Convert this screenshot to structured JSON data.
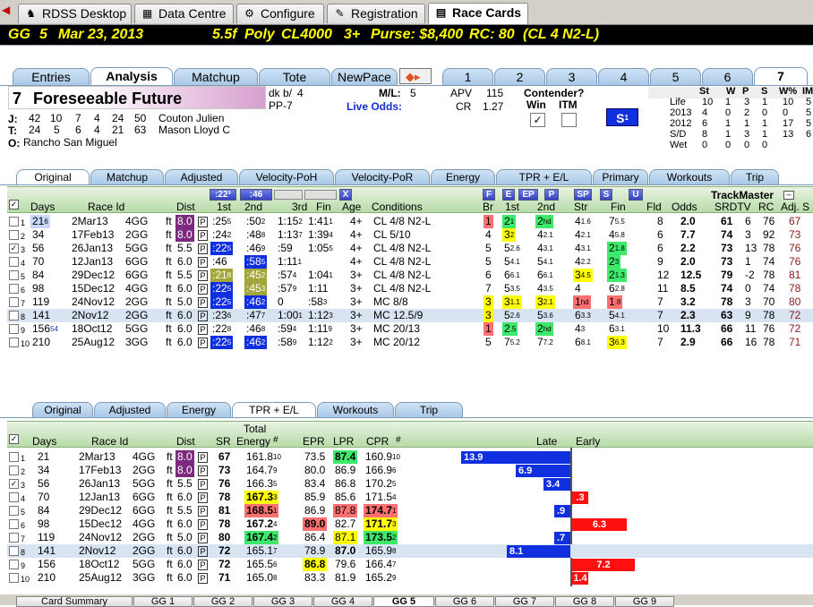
{
  "app_tabs": [
    {
      "label": "RDSS Desktop"
    },
    {
      "label": "Data Centre"
    },
    {
      "label": "Configure"
    },
    {
      "label": "Registration"
    },
    {
      "label": "Race Cards"
    }
  ],
  "race_header": {
    "track": "GG",
    "race": "5",
    "date": "Mar 23, 2013",
    "dist": "5.5f",
    "surface": "Poly",
    "class": "CL4000",
    "age": "3+",
    "purse": "Purse: $8,400",
    "rc": "RC: 80",
    "class_desc": "(CL 4 N2-L)"
  },
  "view_tabs": [
    "Entries",
    "Analysis",
    "Matchup",
    "Tote",
    "NewPace"
  ],
  "horse_tabs": [
    "1",
    "2",
    "3",
    "4",
    "5",
    "6",
    "7"
  ],
  "horse": {
    "pp": "7",
    "name": "Foreseeable Future",
    "color": "dk b/",
    "age": "4",
    "ppnum": "PP-7",
    "ml_label": "M/L:",
    "ml": "5",
    "live_odds": "Live Odds:",
    "apv_label": "APV",
    "apv": "115",
    "cr_label": "CR",
    "cr": "1.27",
    "contender": "Contender?",
    "win": "Win",
    "itm": "ITM",
    "s_badge": "S",
    "s_sup": "1"
  },
  "jockey": {
    "j": "J:",
    "stats": [
      "42",
      "10",
      "7",
      "4",
      "24",
      "50"
    ],
    "name": "Couton Julien"
  },
  "trainer": {
    "t": "T:",
    "stats": [
      "24",
      "5",
      "6",
      "4",
      "21",
      "63"
    ],
    "name": "Mason Lloyd C"
  },
  "owner": {
    "o": "O:",
    "name": "Rancho San Miguel"
  },
  "life_stats": {
    "headers": [
      "St",
      "W",
      "P",
      "S",
      "W%",
      "IM"
    ],
    "rows": [
      [
        "Life",
        "10",
        "1",
        "3",
        "1",
        "10",
        "5"
      ],
      [
        "2013",
        "4",
        "0",
        "2",
        "0",
        "0",
        "5"
      ],
      [
        "2012",
        "6",
        "1",
        "1",
        "1",
        "17",
        "5"
      ],
      [
        "S/D",
        "8",
        "1",
        "3",
        "1",
        "13",
        "6"
      ],
      [
        "Wet",
        "0",
        "0",
        "0",
        "0",
        "",
        ""
      ]
    ]
  },
  "pp_tabs": [
    "Original",
    "Matchup",
    "Adjusted",
    "Velocity-PoH",
    "Velocity-PoR",
    "Energy",
    "TPR + E/L",
    "Primary",
    "Workouts",
    "Trip"
  ],
  "pp_headers": {
    "days": "Days",
    "race_id": "Race Id",
    "dist": "Dist",
    "first": "1st",
    "second": "2nd",
    "third": "3rd",
    "fin": "Fin",
    "age": "Age",
    "conditions": "Conditions",
    "br": "Br",
    "c1": "1st",
    "c2": "2nd",
    "str": "Str",
    "fin2": "Fin",
    "fld": "Fld",
    "odds": "Odds",
    "srdtv": "SRDTV",
    "rc": "RC",
    "adj": "Adj. S",
    "trackmaster": "TrackMaster",
    "b223": ":22³",
    "b46": ":46",
    "bx": "X",
    "bF": "F",
    "bE": "E",
    "bEP": "EP",
    "bP": "P",
    "bSP": "SP",
    "bS": "S",
    "bU": "U"
  },
  "pp_rows": [
    {
      "n": "1",
      "days": "21",
      "dsup": "6",
      "date": "2Mar13",
      "trk": "4GG",
      "sf": "ft",
      "dist": "8.0",
      "f1": ":25",
      "f1s": "5",
      "f2": ":50",
      "f2s": "2",
      "f3": "1:15",
      "f3s": "2",
      "fin": "1:41",
      "fins": "1",
      "age": "4+",
      "cond": "CL 4/8 N2-L",
      "br": "1",
      "c1": "2",
      "c1s": "1",
      "c2": "2",
      "c2s": "hd",
      "str": "4",
      "strs": "1.6",
      "fn": "7",
      "fns": "5.5",
      "fld": "8",
      "odds": "2.0",
      "sr": "61",
      "tv": "6",
      "rc": "76",
      "adj": "67"
    },
    {
      "n": "2",
      "days": "34",
      "dsup": "",
      "date": "17Feb13",
      "trk": "2GG",
      "sf": "ft",
      "dist": "8.0",
      "f1": ":24",
      "f1s": "2",
      "f2": ":48",
      "f2s": "8",
      "f3": "1:13",
      "f3s": "7",
      "fin": "1:39",
      "fins": "4",
      "age": "4+",
      "cond": "CL 5/10",
      "br": "4",
      "c1": "3",
      "c1s": "2",
      "c2": "4",
      "c2s": "2.1",
      "str": "4",
      "strs": "2.1",
      "fn": "4",
      "fns": "5.8",
      "fld": "6",
      "odds": "7.7",
      "sr": "74",
      "tv": "3",
      "rc": "92",
      "adj": "73"
    },
    {
      "n": "3",
      "days": "56",
      "dsup": "",
      "date": "26Jan13",
      "trk": "5GG",
      "sf": "ft",
      "dist": "5.5",
      "f1": ":22",
      "f1s": "5",
      "f2": ":46",
      "f2s": "9",
      "f3": ":59",
      "f3s": "",
      "fin": "1:05",
      "fins": "5",
      "age": "4+",
      "cond": "CL 4/8 N2-L",
      "br": "5",
      "c1": "5",
      "c1s": "2.6",
      "c2": "4",
      "c2s": "3.1",
      "str": "4",
      "strs": "3.1",
      "fn": "2",
      "fns": "1.8",
      "fld": "6",
      "odds": "2.2",
      "sr": "73",
      "tv": "13",
      "rc": "78",
      "adj": "76"
    },
    {
      "n": "4",
      "days": "70",
      "dsup": "",
      "date": "12Jan13",
      "trk": "6GG",
      "sf": "ft",
      "dist": "6.0",
      "f1": ":46",
      "f1s": "",
      "f2": ":58",
      "f2s": "5",
      "f3": "1:11",
      "f3s": "1",
      "fin": "",
      "fins": "",
      "age": "4+",
      "cond": "CL 4/8 N2-L",
      "br": "5",
      "c1": "5",
      "c1s": "4.1",
      "c2": "5",
      "c2s": "4.1",
      "str": "4",
      "strs": "2.2",
      "fn": "2",
      "fns": "3",
      "fld": "9",
      "odds": "2.0",
      "sr": "73",
      "tv": "1",
      "rc": "74",
      "adj": "76"
    },
    {
      "n": "5",
      "days": "84",
      "dsup": "",
      "date": "29Dec12",
      "trk": "6GG",
      "sf": "ft",
      "dist": "5.5",
      "f1": ":21",
      "f1s": "8",
      "f2": ":45",
      "f2s": "2",
      "f3": ":57",
      "f3s": "4",
      "fin": "1:04",
      "fins": "1",
      "age": "3+",
      "cond": "CL 4/8 N2-L",
      "br": "6",
      "c1": "6",
      "c1s": "6.1",
      "c2": "6",
      "c2s": "6.1",
      "str": "3",
      "strs": "4.5",
      "fn": "2",
      "fns": "1.3",
      "fld": "12",
      "odds": "12.5",
      "sr": "79",
      "tv": "-2",
      "rc": "78",
      "adj": "81"
    },
    {
      "n": "6",
      "days": "98",
      "dsup": "",
      "date": "15Dec12",
      "trk": "4GG",
      "sf": "ft",
      "dist": "6.0",
      "f1": ":22",
      "f1s": "5",
      "f2": ":45",
      "f2s": "3",
      "f3": ":57",
      "f3s": "9",
      "fin": "1:11",
      "fins": "",
      "age": "3+",
      "cond": "CL 4/8 N2-L",
      "br": "7",
      "c1": "5",
      "c1s": "3.5",
      "c2": "4",
      "c2s": "3.5",
      "str": "4",
      "strs": "",
      "fn": "6",
      "fns": "2.8",
      "fld": "11",
      "odds": "8.5",
      "sr": "74",
      "tv": "0",
      "rc": "74",
      "adj": "78"
    },
    {
      "n": "7",
      "days": "119",
      "dsup": "",
      "date": "24Nov12",
      "trk": "2GG",
      "sf": "ft",
      "dist": "5.0",
      "f1": ":22",
      "f1s": "5",
      "f2": ":46",
      "f2s": "2",
      "f3": "0",
      "f3s": "",
      "fin": ":58",
      "fins": "3",
      "age": "3+",
      "cond": "MC 8/8",
      "br": "3",
      "c1": "3",
      "c1s": "1.1",
      "c2": "3",
      "c2s": "2.1",
      "str": "1",
      "strs": "hd",
      "fn": "1",
      "fns": ".8",
      "fld": "7",
      "odds": "3.2",
      "sr": "78",
      "tv": "3",
      "rc": "70",
      "adj": "80"
    },
    {
      "n": "8",
      "days": "141",
      "dsup": "",
      "date": "2Nov12",
      "trk": "2GG",
      "sf": "ft",
      "dist": "6.0",
      "f1": ":23",
      "f1s": "6",
      "f2": ":47",
      "f2s": "7",
      "f3": "1:00",
      "f3s": "1",
      "fin": "1:12",
      "fins": "3",
      "age": "3+",
      "cond": "MC 12.5/9",
      "br": "3",
      "c1": "5",
      "c1s": "2.6",
      "c2": "5",
      "c2s": "3.6",
      "str": "6",
      "strs": "3.3",
      "fn": "5",
      "fns": "4.1",
      "fld": "7",
      "odds": "2.3",
      "sr": "63",
      "tv": "9",
      "rc": "78",
      "adj": "72"
    },
    {
      "n": "9",
      "days": "156",
      "dsup": "54",
      "date": "18Oct12",
      "trk": "5GG",
      "sf": "ft",
      "dist": "6.0",
      "f1": ":22",
      "f1s": "8",
      "f2": ":46",
      "f2s": "8",
      "f3": ":59",
      "f3s": "4",
      "fin": "1:11",
      "fins": "9",
      "age": "3+",
      "cond": "MC 20/13",
      "br": "1",
      "c1": "2",
      "c1s": ".5",
      "c2": "2",
      "c2s": "hd",
      "str": "4",
      "strs": "3",
      "fn": "6",
      "fns": "3.1",
      "fld": "10",
      "odds": "11.3",
      "sr": "66",
      "tv": "11",
      "rc": "76",
      "adj": "72"
    },
    {
      "n": "10",
      "days": "210",
      "dsup": "",
      "date": "25Aug12",
      "trk": "3GG",
      "sf": "ft",
      "dist": "6.0",
      "f1": ":22",
      "f1s": "5",
      "f2": ":46",
      "f2s": "2",
      "f3": ":58",
      "f3s": "9",
      "fin": "1:12",
      "fins": "2",
      "age": "3+",
      "cond": "MC 20/12",
      "br": "5",
      "c1": "7",
      "c1s": "5.2",
      "c2": "7",
      "c2s": "7.2",
      "str": "6",
      "strs": "8.1",
      "fn": "3",
      "fns": "6.3",
      "fld": "7",
      "odds": "2.9",
      "sr": "66",
      "tv": "16",
      "rc": "78",
      "adj": "71"
    }
  ],
  "lower_tabs": [
    "Original",
    "Adjusted",
    "Energy",
    "TPR + E/L",
    "Workouts",
    "Trip"
  ],
  "lower_headers": {
    "days": "Days",
    "race_id": "Race Id",
    "dist": "Dist",
    "sr": "SR",
    "total": "Total",
    "energy": "Energy",
    "hash": "#",
    "epr": "EPR",
    "lpr": "LPR",
    "cpr": "CPR",
    "hash2": "#",
    "late": "Late",
    "early": "Early"
  },
  "lower_rows": [
    {
      "n": "1",
      "days": "21",
      "date": "2Mar13",
      "trk": "4GG",
      "sf": "ft",
      "dist": "8.0",
      "sr": "67",
      "energy": "161.8",
      "es": "10",
      "epr": "73.5",
      "lpr": "87.4",
      "cpr": "160.9",
      "cs": "10",
      "late": "13.9",
      "early": ""
    },
    {
      "n": "2",
      "days": "34",
      "date": "17Feb13",
      "trk": "2GG",
      "sf": "ft",
      "dist": "8.0",
      "sr": "73",
      "energy": "164.7",
      "es": "9",
      "epr": "80.0",
      "lpr": "86.9",
      "cpr": "166.9",
      "cs": "6",
      "late": "6.9",
      "early": ""
    },
    {
      "n": "3",
      "days": "56",
      "date": "26Jan13",
      "trk": "5GG",
      "sf": "ft",
      "dist": "5.5",
      "sr": "76",
      "energy": "166.3",
      "es": "5",
      "epr": "83.4",
      "lpr": "86.8",
      "cpr": "170.2",
      "cs": "5",
      "late": "3.4",
      "early": ""
    },
    {
      "n": "4",
      "days": "70",
      "date": "12Jan13",
      "trk": "6GG",
      "sf": "ft",
      "dist": "6.0",
      "sr": "78",
      "energy": "167.3",
      "es": "3",
      "epr": "85.9",
      "lpr": "85.6",
      "cpr": "171.5",
      "cs": "4",
      "late": "",
      "early": ".3"
    },
    {
      "n": "5",
      "days": "84",
      "date": "29Dec12",
      "trk": "6GG",
      "sf": "ft",
      "dist": "5.5",
      "sr": "81",
      "energy": "168.5",
      "es": "1",
      "epr": "86.9",
      "lpr": "87.8",
      "cpr": "174.7",
      "cs": "1",
      "late": ".9",
      "early": ""
    },
    {
      "n": "6",
      "days": "98",
      "date": "15Dec12",
      "trk": "4GG",
      "sf": "ft",
      "dist": "6.0",
      "sr": "78",
      "energy": "167.2",
      "es": "4",
      "epr": "89.0",
      "lpr": "82.7",
      "cpr": "171.7",
      "cs": "3",
      "late": "",
      "early": "6.3"
    },
    {
      "n": "7",
      "days": "119",
      "date": "24Nov12",
      "trk": "2GG",
      "sf": "ft",
      "dist": "5.0",
      "sr": "80",
      "energy": "167.4",
      "es": "2",
      "epr": "86.4",
      "lpr": "87.1",
      "cpr": "173.5",
      "cs": "2",
      "late": ".7",
      "early": ""
    },
    {
      "n": "8",
      "days": "141",
      "date": "2Nov12",
      "trk": "2GG",
      "sf": "ft",
      "dist": "6.0",
      "sr": "72",
      "energy": "165.1",
      "es": "7",
      "epr": "78.9",
      "lpr": "87.0",
      "cpr": "165.9",
      "cs": "8",
      "late": "8.1",
      "early": ""
    },
    {
      "n": "9",
      "days": "156",
      "date": "18Oct12",
      "trk": "5GG",
      "sf": "ft",
      "dist": "6.0",
      "sr": "72",
      "energy": "165.5",
      "es": "6",
      "epr": "86.8",
      "lpr": "79.6",
      "cpr": "166.4",
      "cs": "7",
      "late": "",
      "early": "7.2"
    },
    {
      "n": "10",
      "days": "210",
      "date": "25Aug12",
      "trk": "3GG",
      "sf": "ft",
      "dist": "6.0",
      "sr": "71",
      "energy": "165.0",
      "es": "8",
      "epr": "83.3",
      "lpr": "81.9",
      "cpr": "165.2",
      "cs": "9",
      "late": "",
      "early": "1.4"
    }
  ],
  "bottom_tabs": [
    "Card Summary",
    "GG 1",
    "GG 2",
    "GG 3",
    "GG 4",
    "GG 5",
    "GG 6",
    "GG 7",
    "GG 8",
    "GG 9"
  ]
}
